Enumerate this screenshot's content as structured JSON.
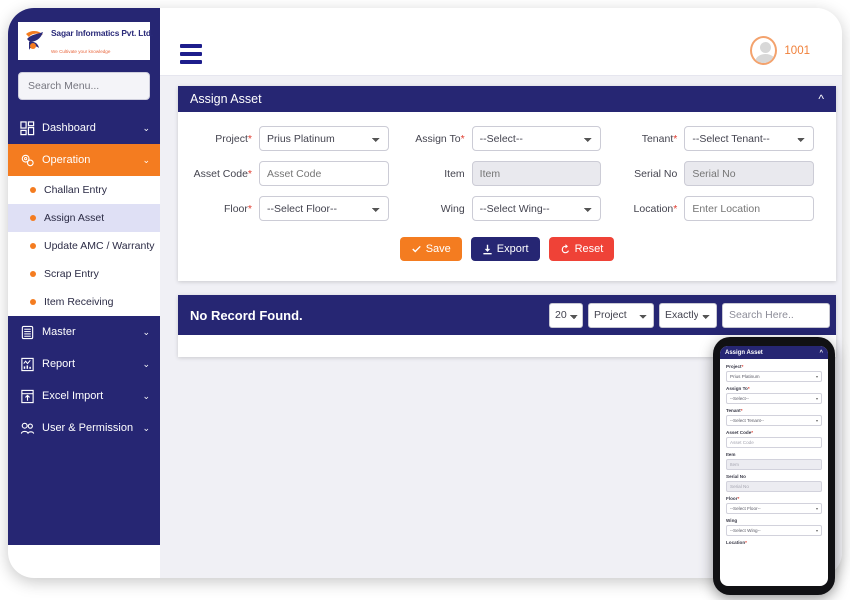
{
  "brand": {
    "name": "Sagar Informatics Pvt. Ltd.",
    "tagline": "We Cultivate your knowledge",
    "logo_icon": "sagar-logo-icon"
  },
  "sidebar": {
    "search_placeholder": "Search Menu...",
    "groups": [
      {
        "label": "Dashboard",
        "icon": "dashboard-grid-icon",
        "active": false,
        "caret": "⌄"
      },
      {
        "label": "Operation",
        "icon": "gears-icon",
        "active": true,
        "caret": "⌄"
      },
      {
        "label": "Master",
        "icon": "database-icon",
        "active": false,
        "caret": "⌄"
      },
      {
        "label": "Report",
        "icon": "report-chart-icon",
        "active": false,
        "caret": "⌄"
      },
      {
        "label": "Excel Import",
        "icon": "excel-import-icon",
        "active": false,
        "caret": "⌄"
      },
      {
        "label": "User & Permission",
        "icon": "users-icon",
        "active": false,
        "caret": "⌄"
      }
    ],
    "operation_items": [
      {
        "label": "Challan Entry",
        "selected": false
      },
      {
        "label": "Assign Asset",
        "selected": true
      },
      {
        "label": "Update AMC / Warranty",
        "selected": false
      },
      {
        "label": "Scrap Entry",
        "selected": false
      },
      {
        "label": "Item Receiving",
        "selected": false
      }
    ]
  },
  "topbar": {
    "menu_icon": "hamburger-icon",
    "avatar_icon": "user-avatar-icon",
    "user_id": "1001"
  },
  "form_card": {
    "title": "Assign Asset",
    "collapse_icon": "chevron-up-icon",
    "fields": {
      "project": {
        "label": "Project",
        "required": true,
        "type": "select",
        "value": "Prius Platinum"
      },
      "assign_to": {
        "label": "Assign To",
        "required": true,
        "type": "select",
        "value": "--Select--"
      },
      "tenant": {
        "label": "Tenant",
        "required": true,
        "type": "select",
        "value": "--Select Tenant--"
      },
      "asset_code": {
        "label": "Asset Code",
        "required": true,
        "type": "text",
        "placeholder": "Asset Code",
        "value": ""
      },
      "item": {
        "label": "Item",
        "required": false,
        "type": "text",
        "placeholder": "Item",
        "value": "",
        "disabled": true
      },
      "serial_no": {
        "label": "Serial No",
        "required": false,
        "type": "text",
        "placeholder": "Serial No",
        "value": "",
        "disabled": true
      },
      "floor": {
        "label": "Floor",
        "required": true,
        "type": "select",
        "value": "--Select Floor--"
      },
      "wing": {
        "label": "Wing",
        "required": false,
        "type": "select",
        "value": "--Select Wing--"
      },
      "location": {
        "label": "Location",
        "required": true,
        "type": "text",
        "placeholder": "Enter Location",
        "value": ""
      }
    },
    "buttons": {
      "save": {
        "label": "Save",
        "icon": "check-icon",
        "color": "#f47c20"
      },
      "export": {
        "label": "Export",
        "icon": "download-icon",
        "color": "#262673"
      },
      "reset": {
        "label": "Reset",
        "icon": "refresh-icon",
        "color": "#ef4237"
      }
    }
  },
  "results_card": {
    "message": "No Record Found.",
    "page_size": "20",
    "field_filter": "Project",
    "match_mode": "Exactly",
    "search_placeholder": "Search Here.."
  },
  "phone_preview": {
    "title": "Assign Asset",
    "collapse_icon": "chevron-up-icon",
    "fields": [
      {
        "label": "Project",
        "required": true,
        "value": "Prius Platinum",
        "type": "select"
      },
      {
        "label": "Assign To",
        "required": true,
        "value": "--Select--",
        "type": "select"
      },
      {
        "label": "Tenant",
        "required": true,
        "value": "--Select Tenant--",
        "type": "select"
      },
      {
        "label": "Asset Code",
        "required": true,
        "value": "Asset Code",
        "type": "text"
      },
      {
        "label": "Item",
        "required": false,
        "value": "Item",
        "type": "text",
        "disabled": true
      },
      {
        "label": "Serial No",
        "required": false,
        "value": "Serial No",
        "type": "text",
        "disabled": true
      },
      {
        "label": "Floor",
        "required": true,
        "value": "--Select Floor--",
        "type": "select"
      },
      {
        "label": "Wing",
        "required": false,
        "value": "--Select Wing--",
        "type": "select"
      },
      {
        "label": "Location",
        "required": true,
        "value": "",
        "type": "text"
      }
    ]
  },
  "colors": {
    "navy": "#262673",
    "orange": "#f47c20",
    "red": "#ef4237",
    "page_bg": "#f0f0f5"
  }
}
